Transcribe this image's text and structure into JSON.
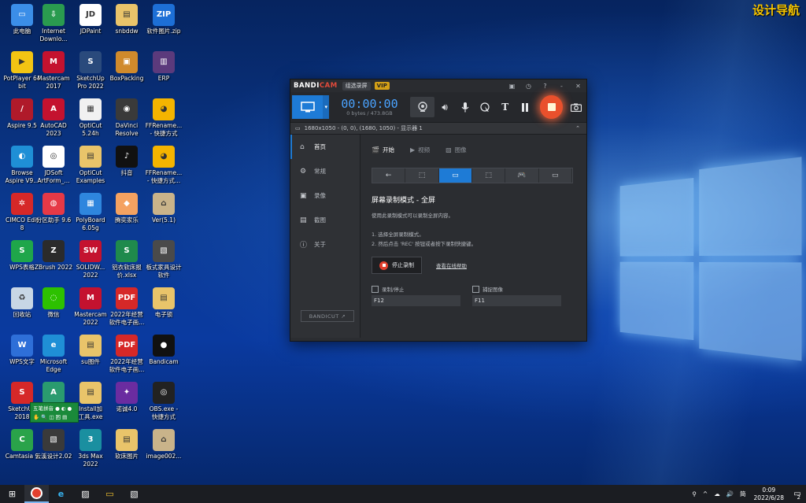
{
  "watermark": "设计导航",
  "desktop_icons": [
    {
      "label": "此电脑",
      "color": "#3b8ee8",
      "glyph": "▭"
    },
    {
      "label": "Internet\nDownlo...",
      "color": "#2a9b4f",
      "glyph": "⇩"
    },
    {
      "label": "JDPaint",
      "color": "#ffffff",
      "glyph": "JD"
    },
    {
      "label": "snbddw",
      "color": "#e9c46a",
      "glyph": "▤"
    },
    {
      "label": "软件图片.zip",
      "color": "#1d6fd6",
      "glyph": "ZIP"
    },
    {
      "label": "PotPlayer 64\nbit",
      "color": "#f2c413",
      "glyph": "▶"
    },
    {
      "label": "Mastercam\n2017",
      "color": "#c4122f",
      "glyph": "M"
    },
    {
      "label": "SketchUp\nPro 2022",
      "color": "#2a4a7c",
      "glyph": "S"
    },
    {
      "label": "BoxPacking",
      "color": "#d08a2c",
      "glyph": "▣"
    },
    {
      "label": "ERP",
      "color": "#5b3a7c",
      "glyph": "▥"
    },
    {
      "label": "Aspire 9.5",
      "color": "#b01a2a",
      "glyph": "/"
    },
    {
      "label": "AutoCAD\n2023",
      "color": "#c4122f",
      "glyph": "A"
    },
    {
      "label": "OptiCut\n5.24h",
      "color": "#f1f1f1",
      "glyph": "▦"
    },
    {
      "label": "DaVinci\nResolve",
      "color": "#3a3a3a",
      "glyph": "◉"
    },
    {
      "label": "FFRename...\n- 快捷方式",
      "color": "#f4b400",
      "glyph": "◕"
    },
    {
      "label": "Browse\nAspire V9...",
      "color": "#1f8fd6",
      "glyph": "◐"
    },
    {
      "label": "JDSoft\nArtForm_...",
      "color": "#ffffff",
      "glyph": "◎"
    },
    {
      "label": "OptiCut\nExamples",
      "color": "#e9c46a",
      "glyph": "▤"
    },
    {
      "label": "抖音",
      "color": "#111111",
      "glyph": "♪"
    },
    {
      "label": "FFRename...\n- 快捷方式...",
      "color": "#f4b400",
      "glyph": "◕"
    },
    {
      "label": "CIMCO Edit\n8",
      "color": "#d62828",
      "glyph": "✲"
    },
    {
      "label": "分区助手 9.6",
      "color": "#e63946",
      "glyph": "◍"
    },
    {
      "label": "PolyBoard\n6.05g",
      "color": "#2e86de",
      "glyph": "▦"
    },
    {
      "label": "腾奕家乐",
      "color": "#f4a261",
      "glyph": "◆"
    },
    {
      "label": "Ver(5.1)",
      "color": "#c9b38a",
      "glyph": "⌂"
    },
    {
      "label": "WPS表格",
      "color": "#1fa64a",
      "glyph": "S"
    },
    {
      "label": "ZBrush 2022",
      "color": "#2b2b2b",
      "glyph": "Z"
    },
    {
      "label": "SOLIDW...\n2022",
      "color": "#c4122f",
      "glyph": "SW"
    },
    {
      "label": "铝衣软床报\n价.xlsx",
      "color": "#1f8a4c",
      "glyph": "S"
    },
    {
      "label": "板式家具设计\n软件",
      "color": "#4a4a4a",
      "glyph": "▧"
    },
    {
      "label": "回收站",
      "color": "#c8d6e5",
      "glyph": "♻"
    },
    {
      "label": "微信",
      "color": "#2dc100",
      "glyph": "◌"
    },
    {
      "label": "Mastercam\n2022",
      "color": "#c4122f",
      "glyph": "M"
    },
    {
      "label": "2022年经营\n软件电子画...",
      "color": "#d62828",
      "glyph": "PDF"
    },
    {
      "label": "电子锁",
      "color": "#e9c46a",
      "glyph": "▤"
    },
    {
      "label": "WPS文字",
      "color": "#2e6fd8",
      "glyph": "W"
    },
    {
      "label": "Microsoft\nEdge",
      "color": "#1f8fd6",
      "glyph": "e"
    },
    {
      "label": "su图件",
      "color": "#e9c46a",
      "glyph": "▤"
    },
    {
      "label": "2022年经营\n软件电子画...",
      "color": "#d62828",
      "glyph": "PDF"
    },
    {
      "label": "Bandicam",
      "color": "#111111",
      "glyph": "●"
    },
    {
      "label": "SketchUp\n2018",
      "color": "#d62828",
      "glyph": "S"
    },
    {
      "label": "AnyCAD",
      "color": "#2a9b6f",
      "glyph": "A"
    },
    {
      "label": "Install加\n工具.exe",
      "color": "#e9c46a",
      "glyph": "▤"
    },
    {
      "label": "诺诚4.0",
      "color": "#6a2ca0",
      "glyph": "✦"
    },
    {
      "label": "OBS.exe -\n快捷方式",
      "color": "#222222",
      "glyph": "◎"
    },
    {
      "label": "Camtasia 9",
      "color": "#2aa34a",
      "glyph": "C"
    },
    {
      "label": "云溪设计2.02",
      "color": "#3a3a3a",
      "glyph": "▧"
    },
    {
      "label": "3ds Max\n2022",
      "color": "#1a8fa0",
      "glyph": "3"
    },
    {
      "label": "软床图片",
      "color": "#e9c46a",
      "glyph": "▤"
    },
    {
      "label": "image002...",
      "color": "#c9b38a",
      "glyph": "⌂"
    }
  ],
  "widget": {
    "row1": "五笔拼音 ● ◐ ●",
    "row2": "✋ 🔍 ◫ 困 ▤"
  },
  "bandicam": {
    "logo_a": "BANDI",
    "logo_b": "CAM",
    "mode_badge": "组选录屏",
    "vip": "VIP",
    "win_buttons": [
      "▣",
      "◷",
      "?",
      "-",
      "✕"
    ],
    "timer": "00:00:00",
    "size": "0 bytes / 473.8GB",
    "region": "1680x1050 - (0, 0), (1680, 1050) - 显示器 1",
    "nav": [
      {
        "icon": "⌂",
        "label": "首页"
      },
      {
        "icon": "⚙",
        "label": "常规"
      },
      {
        "icon": "▣",
        "label": "录像"
      },
      {
        "icon": "▤",
        "label": "截图"
      },
      {
        "icon": "ⓘ",
        "label": "关于"
      }
    ],
    "bandicut": "BANDICUT ↗",
    "tabs": [
      {
        "icon": "🎬",
        "label": "开始"
      },
      {
        "icon": "▶",
        "label": "视频"
      },
      {
        "icon": "▧",
        "label": "图像"
      }
    ],
    "modes": [
      "←",
      "⬚",
      "▭",
      "⬚",
      "🎮",
      "▭"
    ],
    "heading": "屏幕录制模式 - 全屏",
    "desc": "使用此录制模式可以录制全屏内容。",
    "step1": "1. 选择全屏录制模式。",
    "step2": "2. 然后点击 'REC' 按钮或者按下录制快捷键。",
    "stop_label": "停止录制",
    "help_link": "查看在线帮助",
    "hotkey_record_label": "录制/停止",
    "hotkey_record_value": "F12",
    "hotkey_capture_label": "捕捉图像",
    "hotkey_capture_value": "F11"
  },
  "taskbar": {
    "items": [
      "⊞",
      "●",
      "e",
      "▨",
      "▭",
      "▧"
    ],
    "tray": [
      "⚲",
      "^",
      "☁",
      "🔊",
      "简"
    ],
    "time": "0:09",
    "date": "2022/6/28",
    "notif": "2"
  }
}
